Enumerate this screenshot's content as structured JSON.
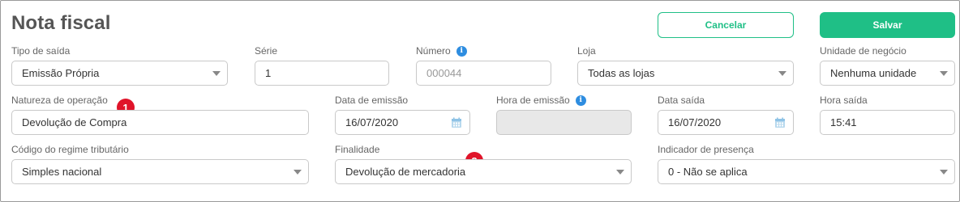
{
  "title": "Nota fiscal",
  "buttons": {
    "cancel": "Cancelar",
    "save": "Salvar"
  },
  "row1": {
    "tipo_saida": {
      "label": "Tipo de saída",
      "value": "Emissão Própria"
    },
    "serie": {
      "label": "Série",
      "value": "1"
    },
    "numero": {
      "label": "Número",
      "placeholder": "000044"
    },
    "loja": {
      "label": "Loja",
      "value": "Todas as lojas"
    },
    "unidade": {
      "label": "Unidade de negócio",
      "value": "Nenhuma unidade"
    }
  },
  "row2": {
    "natureza": {
      "label": "Natureza de operação",
      "value": "Devolução de Compra"
    },
    "data_emissao": {
      "label": "Data de emissão",
      "value": "16/07/2020"
    },
    "hora_emissao": {
      "label": "Hora de emissão",
      "value": ""
    },
    "data_saida": {
      "label": "Data saída",
      "value": "16/07/2020"
    },
    "hora_saida": {
      "label": "Hora saída",
      "value": "15:41"
    }
  },
  "row3": {
    "regime": {
      "label": "Código do regime tributário",
      "value": "Simples nacional"
    },
    "finalidade": {
      "label": "Finalidade",
      "value": "Devolução de mercadoria"
    },
    "presenca": {
      "label": "Indicador de presença",
      "value": "0 - Não se aplica"
    }
  },
  "annotations": {
    "badge1": "1",
    "badge2": "2"
  },
  "icons": {
    "info": "info-icon",
    "calendar": "calendar-icon",
    "dropdown": "chevron-down-icon"
  },
  "colors": {
    "accent": "#1fbf86",
    "info": "#2e8de0",
    "badge": "#e0142a"
  }
}
